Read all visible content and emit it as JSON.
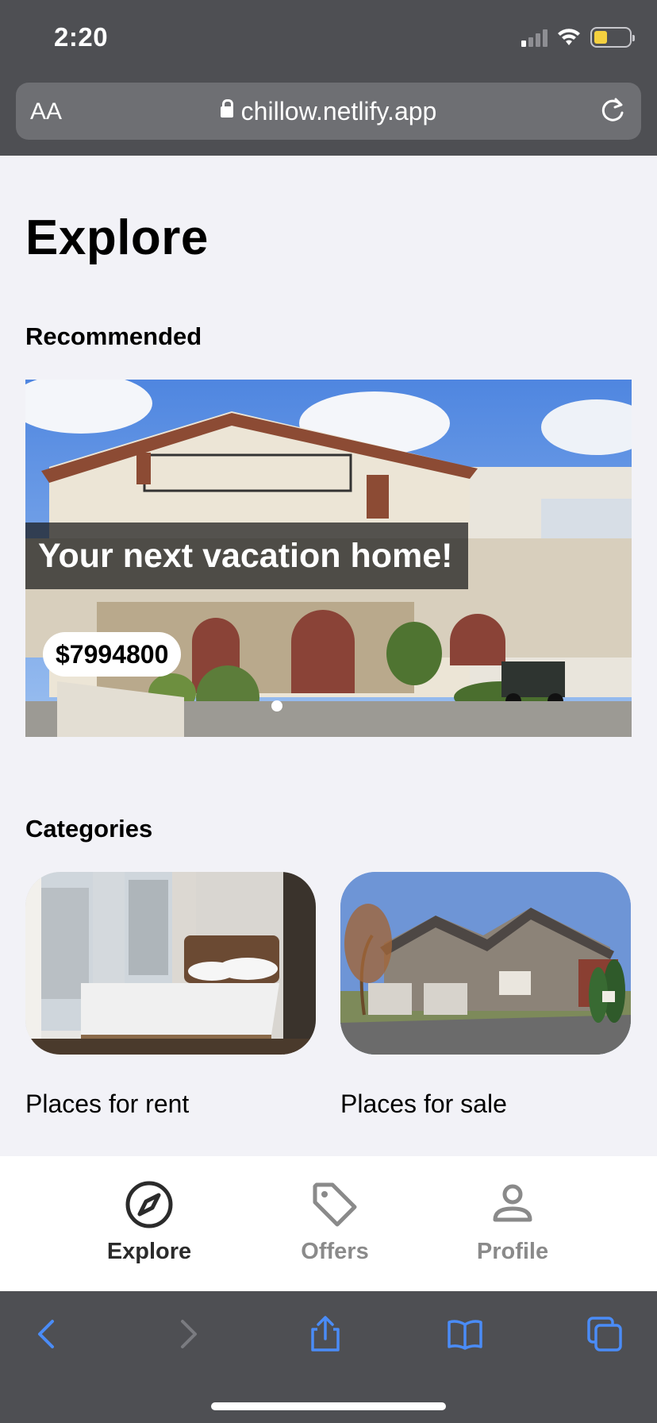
{
  "status_bar": {
    "time": "2:20"
  },
  "address_bar": {
    "text_size_label": "AA",
    "url": "chillow.netlify.app"
  },
  "page": {
    "title": "Explore"
  },
  "recommended": {
    "section_title": "Recommended",
    "caption": "Your next vacation home!",
    "price": "$7994800",
    "carousel_active_index": 0
  },
  "categories": {
    "section_title": "Categories",
    "items": [
      {
        "label": "Places for rent",
        "image": "bedroom-photo"
      },
      {
        "label": "Places for sale",
        "image": "house-photo"
      }
    ]
  },
  "tab_bar": {
    "active": "Explore",
    "tabs": [
      {
        "label": "Explore",
        "icon": "compass-icon"
      },
      {
        "label": "Offers",
        "icon": "tag-icon"
      },
      {
        "label": "Profile",
        "icon": "person-icon"
      }
    ]
  },
  "browser_toolbar": {
    "buttons": [
      "back-icon",
      "forward-icon",
      "share-icon",
      "bookmarks-icon",
      "tabs-icon"
    ],
    "accent_color": "#4a8cf7"
  },
  "colors": {
    "chrome": "#4e4f53",
    "page_background": "#f2f2f7",
    "inactive_tab": "#8a8a8a"
  }
}
